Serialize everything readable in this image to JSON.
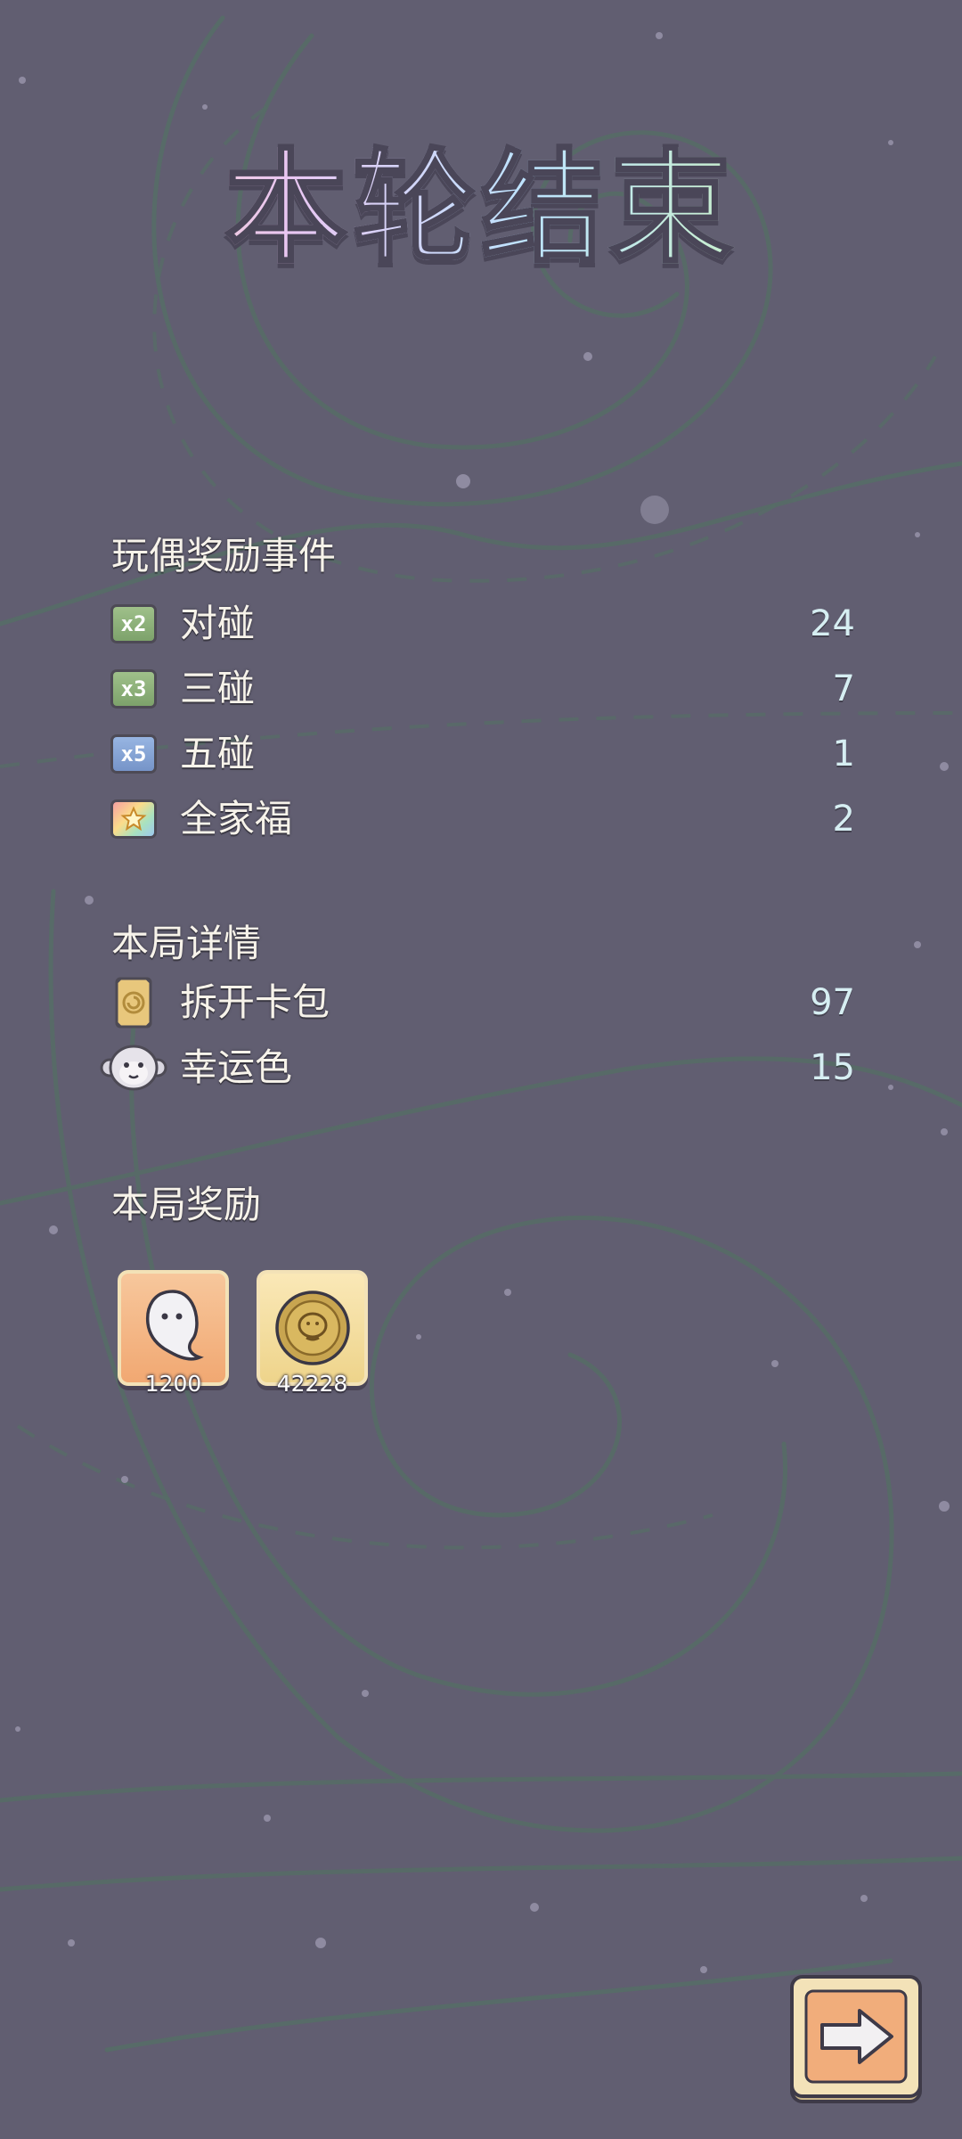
{
  "title": "本轮结束",
  "doll_events": {
    "title": "玩偶奖励事件",
    "items": [
      {
        "badge": "x2",
        "label": "对碰",
        "value": "24",
        "icon": "x2-badge-icon"
      },
      {
        "badge": "x3",
        "label": "三碰",
        "value": "7",
        "icon": "x3-badge-icon"
      },
      {
        "badge": "x5",
        "label": "五碰",
        "value": "1",
        "icon": "x5-badge-icon"
      },
      {
        "badge": "",
        "label": "全家福",
        "value": "2",
        "icon": "star-badge-icon"
      }
    ]
  },
  "round_details": {
    "title": "本局详情",
    "items": [
      {
        "label": "拆开卡包",
        "value": "97",
        "icon": "card-pack-icon"
      },
      {
        "label": "幸运色",
        "value": "15",
        "icon": "monkey-icon"
      }
    ]
  },
  "round_rewards": {
    "title": "本局奖励",
    "items": [
      {
        "count": "1200",
        "icon": "ghost-currency-icon"
      },
      {
        "count": "42228",
        "icon": "gold-coin-icon"
      }
    ]
  },
  "colors": {
    "background": "#615e71",
    "swirl": "#4f6b63",
    "text": "#f7f3ea",
    "value_text": "#d6eef2"
  }
}
